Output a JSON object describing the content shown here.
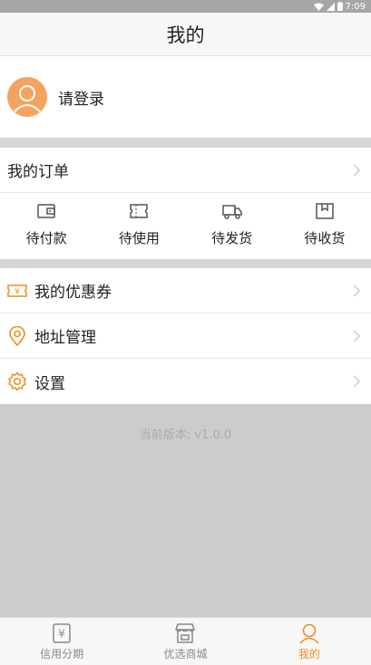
{
  "status_bar": {
    "time": "7:09"
  },
  "header": {
    "title": "我的"
  },
  "profile": {
    "login_text": "请登录"
  },
  "orders": {
    "label": "我的订单",
    "types": [
      {
        "label": "待付款",
        "icon": "wallet-icon"
      },
      {
        "label": "待使用",
        "icon": "ticket-icon"
      },
      {
        "label": "待发货",
        "icon": "truck-icon"
      },
      {
        "label": "待收货",
        "icon": "package-icon"
      }
    ]
  },
  "menu": {
    "items": [
      {
        "label": "我的优惠券",
        "icon": "coupon-icon"
      },
      {
        "label": "地址管理",
        "icon": "location-pin-icon"
      },
      {
        "label": "设置",
        "icon": "gear-icon"
      }
    ]
  },
  "version": "当前版本: v1.0.0",
  "tabbar": {
    "tabs": [
      {
        "label": "信用分期",
        "icon": "yen-icon",
        "active": false
      },
      {
        "label": "优选商城",
        "icon": "store-icon",
        "active": false
      },
      {
        "label": "我的",
        "icon": "person-icon",
        "active": true
      }
    ]
  },
  "colors": {
    "accent": "#f08c1e",
    "avatar": "#f4a460",
    "icon_gray": "#555555"
  }
}
